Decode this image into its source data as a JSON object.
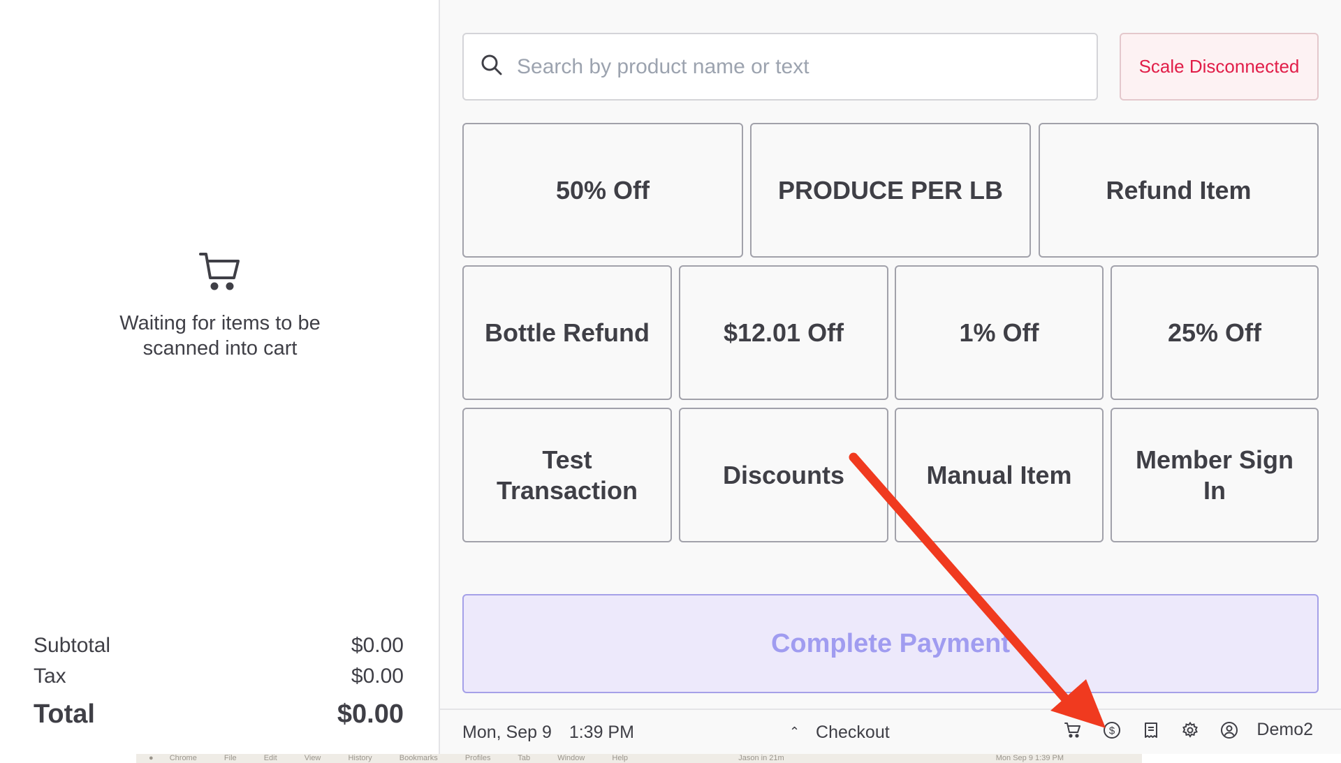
{
  "cart": {
    "empty_message": "Waiting for items to be scanned into cart",
    "subtotal_label": "Subtotal",
    "subtotal_value": "$0.00",
    "tax_label": "Tax",
    "tax_value": "$0.00",
    "total_label": "Total",
    "total_value": "$0.00"
  },
  "search": {
    "placeholder": "Search by product name or text"
  },
  "scale_status": "Scale Disconnected",
  "tiles": {
    "r1": [
      "50% Off",
      "PRODUCE PER LB",
      "Refund Item"
    ],
    "r2": [
      "Bottle Refund",
      "$12.01 Off",
      "1% Off",
      "25% Off"
    ],
    "r3": [
      "Test Transaction",
      "Discounts",
      "Manual Item",
      "Member Sign In"
    ]
  },
  "complete_payment_label": "Complete Payment",
  "statusbar": {
    "date": "Mon, Sep 9",
    "time": "1:39 PM",
    "checkout_label": "Checkout",
    "user": "Demo2"
  },
  "os_menubar": {
    "items": [
      "Chrome",
      "File",
      "Edit",
      "View",
      "History",
      "Bookmarks",
      "Profiles",
      "Tab",
      "Window",
      "Help"
    ],
    "right_text": "Jason in 21m",
    "clock": "Mon Sep 9  1:39 PM"
  },
  "colors": {
    "accent": "#a09cf0",
    "warning": "#e11d48",
    "annotation_arrow": "#f03a1f"
  }
}
